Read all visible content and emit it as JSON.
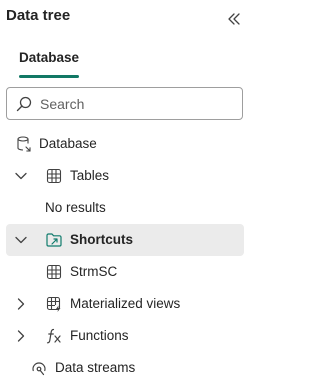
{
  "panel": {
    "title": "Data tree"
  },
  "tabs": [
    {
      "label": "Database",
      "active": true
    }
  ],
  "search": {
    "placeholder": "Search",
    "value": ""
  },
  "tree": {
    "database": {
      "label": "Database",
      "icon": "database-shortcut-icon"
    },
    "tables": {
      "label": "Tables",
      "icon": "table-icon",
      "expanded": true,
      "empty_message": "No results"
    },
    "shortcuts": {
      "label": "Shortcuts",
      "icon": "shortcut-folder-icon",
      "expanded": true,
      "selected": true,
      "children": [
        {
          "label": "StrmSC",
          "icon": "table-icon"
        }
      ]
    },
    "materialized_views": {
      "label": "Materialized views",
      "icon": "materialized-view-icon",
      "expanded": false
    },
    "functions": {
      "label": "Functions",
      "icon": "function-icon",
      "expanded": false
    },
    "data_streams": {
      "label": "Data streams",
      "icon": "data-stream-icon"
    }
  },
  "colors": {
    "accent": "#117865",
    "selected_row": "#ebebeb",
    "text": "#242424",
    "shortcut_icon": "#0f7b6c"
  }
}
